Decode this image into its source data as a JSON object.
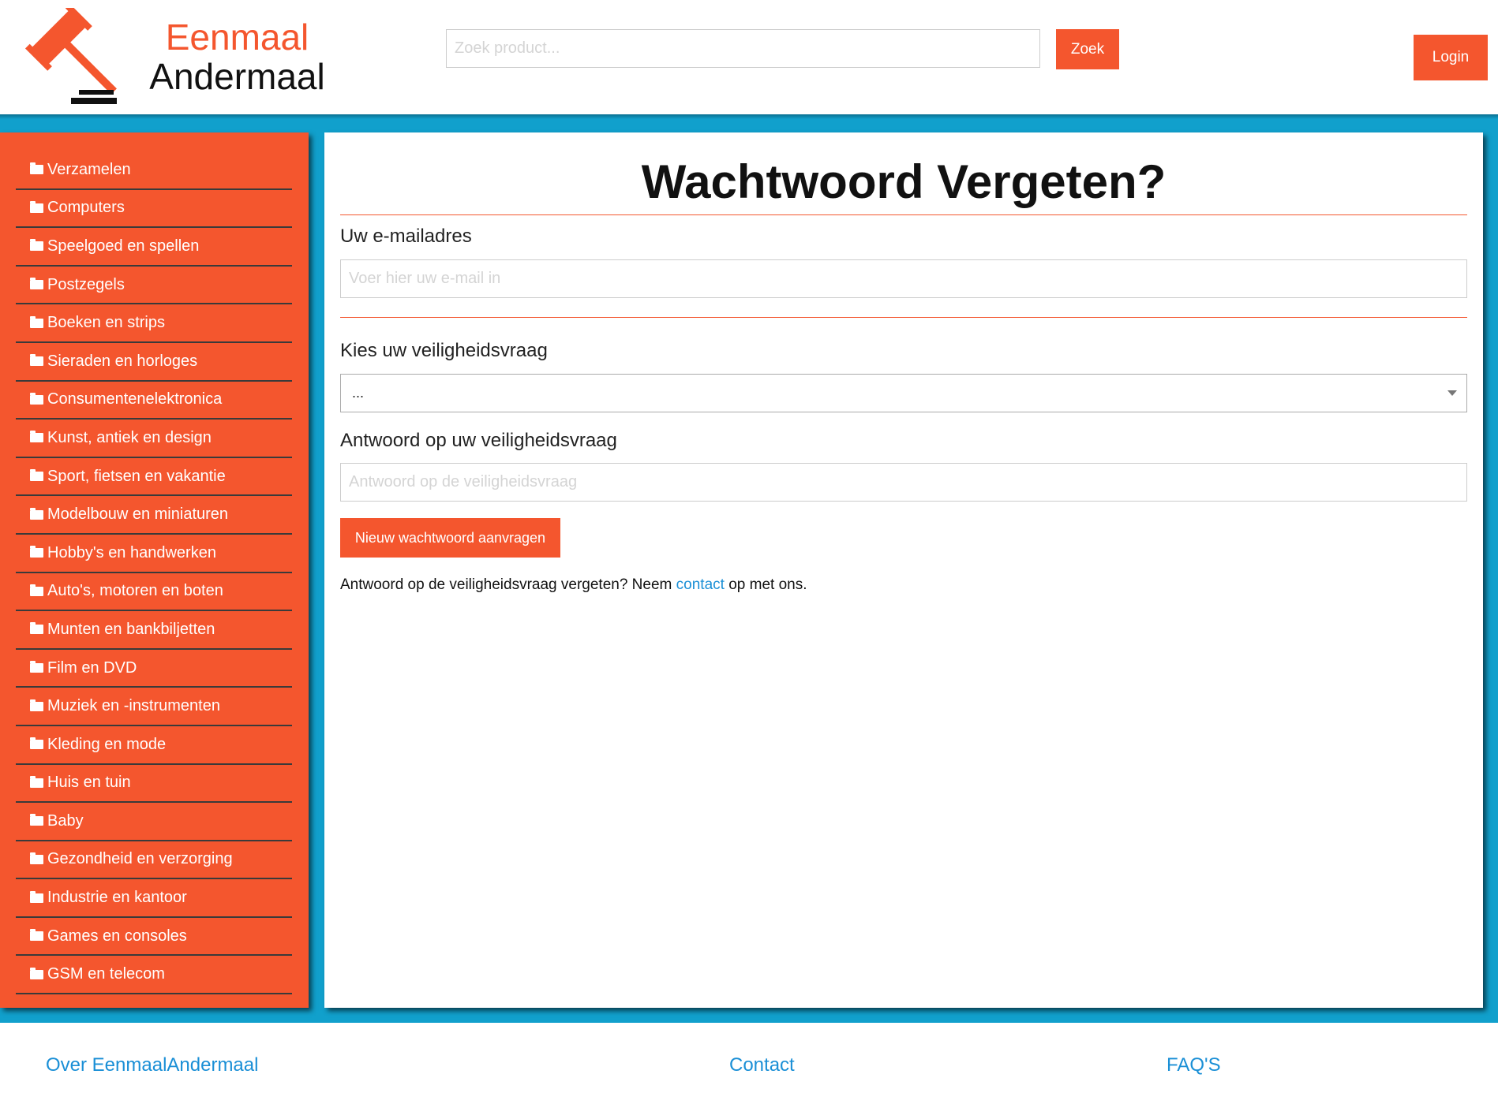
{
  "header": {
    "logo_line1": "Eenmaal",
    "logo_line2": "Andermaal",
    "logo_icon": "auction-gavel-icon",
    "search_placeholder": "Zoek product...",
    "search_button": "Zoek",
    "login_button": "Login"
  },
  "sidebar": {
    "items": [
      {
        "label": "Verzamelen",
        "icon": "folder-icon"
      },
      {
        "label": "Computers",
        "icon": "folder-icon"
      },
      {
        "label": "Speelgoed en spellen",
        "icon": "folder-icon"
      },
      {
        "label": "Postzegels",
        "icon": "folder-icon"
      },
      {
        "label": "Boeken en strips",
        "icon": "folder-icon"
      },
      {
        "label": "Sieraden en horloges",
        "icon": "folder-icon"
      },
      {
        "label": "Consumentenelektronica",
        "icon": "folder-icon"
      },
      {
        "label": "Kunst, antiek en design",
        "icon": "folder-icon"
      },
      {
        "label": "Sport, fietsen en vakantie",
        "icon": "folder-icon"
      },
      {
        "label": "Modelbouw en miniaturen",
        "icon": "folder-icon"
      },
      {
        "label": "Hobby's en handwerken",
        "icon": "folder-icon"
      },
      {
        "label": "Auto's, motoren en boten",
        "icon": "folder-icon"
      },
      {
        "label": "Munten en bankbiljetten",
        "icon": "folder-icon"
      },
      {
        "label": "Film en DVD",
        "icon": "folder-icon"
      },
      {
        "label": "Muziek en -instrumenten",
        "icon": "folder-icon"
      },
      {
        "label": "Kleding en mode",
        "icon": "folder-icon"
      },
      {
        "label": "Huis en tuin",
        "icon": "folder-icon"
      },
      {
        "label": "Baby",
        "icon": "folder-icon"
      },
      {
        "label": "Gezondheid en verzorging",
        "icon": "folder-icon"
      },
      {
        "label": "Industrie en kantoor",
        "icon": "folder-icon"
      },
      {
        "label": "Games en consoles",
        "icon": "folder-icon"
      },
      {
        "label": "GSM en telecom",
        "icon": "folder-icon"
      }
    ]
  },
  "main": {
    "title": "Wachtwoord Vergeten?",
    "email_label": "Uw e-mailadres",
    "email_placeholder": "Voer hier uw e-mail in",
    "question_label": "Kies uw veiligheidsvraag",
    "question_selected": "...",
    "answer_label": "Antwoord op uw veiligheidsvraag",
    "answer_placeholder": "Antwoord op de veiligheidsvraag",
    "submit_button": "Nieuw wachtwoord aanvragen",
    "help_before": "Antwoord op de veiligheidsvraag vergeten? Neem ",
    "help_link": "contact",
    "help_after": " op met ons."
  },
  "footer": {
    "about_link": "Over EenmaalAndermaal",
    "contact_link": "Contact",
    "faq_link": "FAQ'S"
  },
  "colors": {
    "accent": "#f4562e",
    "band": "#11a0cc",
    "link": "#1a8fd6"
  }
}
